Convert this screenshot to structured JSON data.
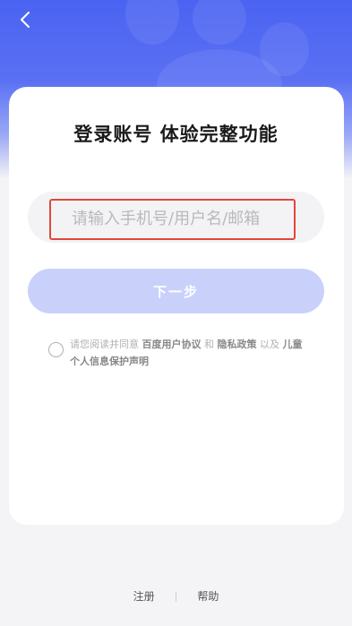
{
  "header": {
    "back_icon": "chevron-left-icon"
  },
  "login": {
    "title": "登录账号 体验完整功能",
    "account_placeholder": "请输入手机号/用户名/邮箱",
    "account_value": "",
    "next_label": "下一步"
  },
  "agreement": {
    "checked": false,
    "prefix": "请您阅读并同意",
    "link1": "百度用户协议",
    "and": "和",
    "link2": "隐私政策",
    "and2": "以及",
    "link3": "儿童个人信息保护声明"
  },
  "footer": {
    "register": "注册",
    "separator": "|",
    "help": "帮助"
  },
  "colors": {
    "brand_blue": "#4a63f1",
    "button_disabled": "#c9d1fb",
    "highlight_red": "#e0483a"
  }
}
